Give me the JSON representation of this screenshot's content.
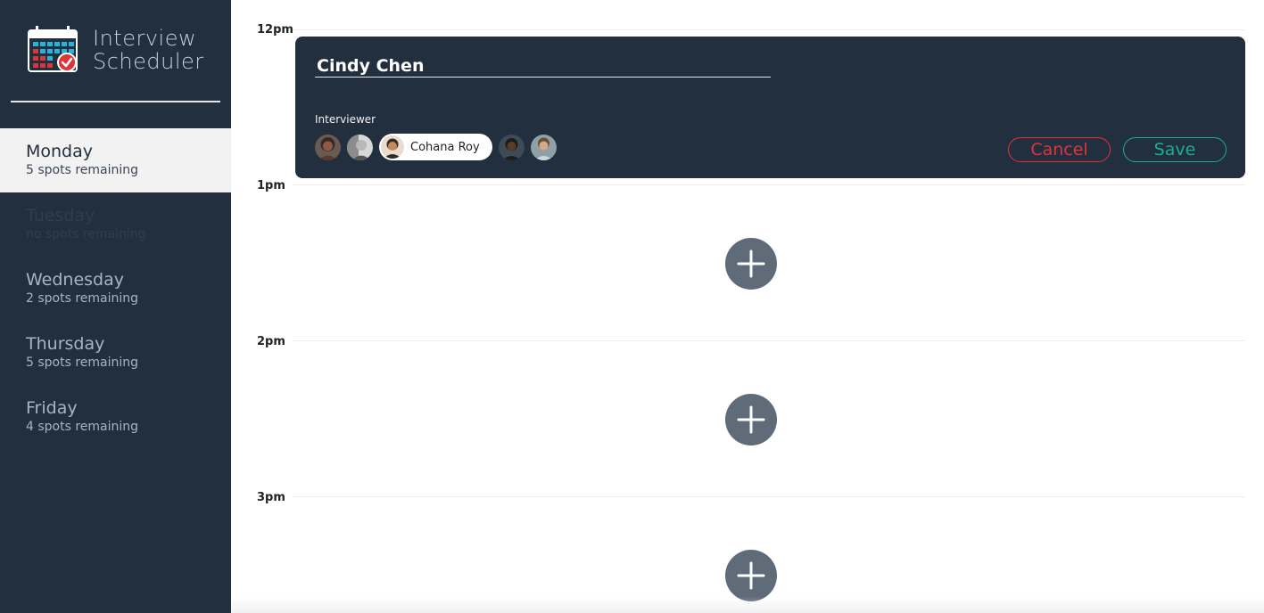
{
  "app": {
    "title_line1": "Interview",
    "title_line2": "Scheduler",
    "logo_icon": "calendar-check-icon"
  },
  "days": [
    {
      "name": "Monday",
      "spots": "5 spots remaining",
      "selected": true
    },
    {
      "name": "Tuesday",
      "spots": "no spots remaining",
      "selected": false
    },
    {
      "name": "Wednesday",
      "spots": "2 spots remaining",
      "selected": false
    },
    {
      "name": "Thursday",
      "spots": "5 spots remaining",
      "selected": false
    },
    {
      "name": "Friday",
      "spots": "4 spots remaining",
      "selected": false
    }
  ],
  "schedule": {
    "hours": [
      "12pm",
      "1pm",
      "2pm",
      "3pm"
    ],
    "add_icon": "plus-icon"
  },
  "form": {
    "student_name": "Cindy Chen",
    "interviewer_label": "Interviewer",
    "selected_interviewer": "Cohana Roy",
    "cancel_label": "Cancel",
    "save_label": "Save"
  },
  "colors": {
    "sidebar_bg": "#222f3e",
    "cancel": "#e0343b",
    "save": "#1cae8e",
    "add_button": "#5f6b78"
  }
}
